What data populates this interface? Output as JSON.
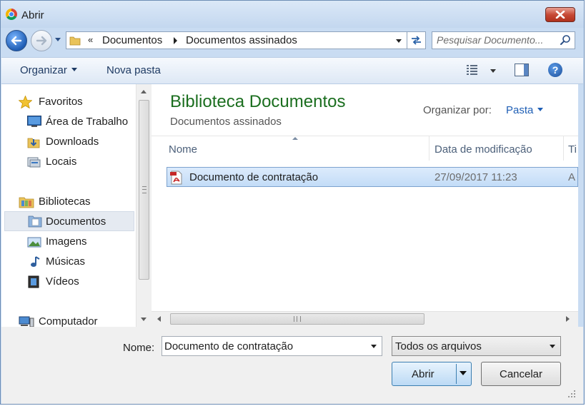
{
  "window": {
    "title": "Abrir",
    "close_icon": "close-icon"
  },
  "address": {
    "overflow_chevron": "«",
    "breadcrumbs": [
      "Documentos",
      "Documentos assinados"
    ]
  },
  "search": {
    "placeholder": "Pesquisar Documento..."
  },
  "toolbar": {
    "organize_label": "Organizar",
    "new_folder_label": "Nova pasta"
  },
  "nav": {
    "favorites_label": "Favoritos",
    "favorites": [
      {
        "label": "Área de Trabalho",
        "icon": "desktop-icon"
      },
      {
        "label": "Downloads",
        "icon": "downloads-icon"
      },
      {
        "label": "Locais",
        "icon": "recent-places-icon"
      }
    ],
    "libraries_label": "Bibliotecas",
    "libraries": [
      {
        "label": "Documentos",
        "icon": "documents-icon",
        "selected": true
      },
      {
        "label": "Imagens",
        "icon": "pictures-icon"
      },
      {
        "label": "Músicas",
        "icon": "music-icon"
      },
      {
        "label": "Vídeos",
        "icon": "videos-icon"
      }
    ],
    "computer_label": "Computador"
  },
  "content": {
    "library_title": "Biblioteca Documentos",
    "library_subtitle": "Documentos assinados",
    "arrange_label": "Organizar por:",
    "arrange_value": "Pasta",
    "columns": {
      "name": "Nome",
      "date": "Data de modificação",
      "type": "Ti"
    },
    "files": [
      {
        "name": "Documento de contratação",
        "date": "27/09/2017 11:23",
        "type": "A",
        "icon": "pdf-icon",
        "selected": true
      }
    ]
  },
  "footer": {
    "name_label": "Nome:",
    "filename_value": "Documento de contratação",
    "filter_value": "Todos os arquivos",
    "open_label": "Abrir",
    "cancel_label": "Cancelar"
  },
  "colors": {
    "library_title": "#1b6e1f",
    "accent_link": "#1f5fb5",
    "selection": "#cce4f7",
    "close_button": "#c74a36"
  }
}
